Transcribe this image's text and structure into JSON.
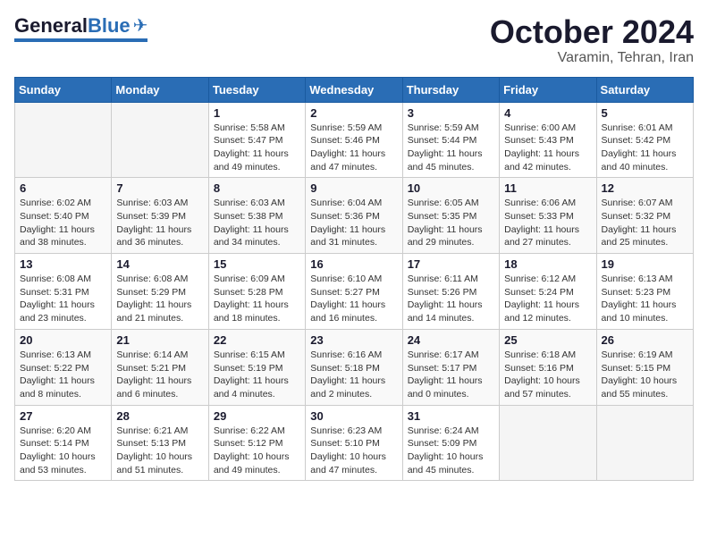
{
  "logo": {
    "general": "General",
    "blue": "Blue",
    "tagline": ""
  },
  "header": {
    "month_title": "October 2024",
    "subtitle": "Varamin, Tehran, Iran"
  },
  "days_of_week": [
    "Sunday",
    "Monday",
    "Tuesday",
    "Wednesday",
    "Thursday",
    "Friday",
    "Saturday"
  ],
  "weeks": [
    [
      {
        "day": "",
        "sunrise": "",
        "sunset": "",
        "daylight": ""
      },
      {
        "day": "",
        "sunrise": "",
        "sunset": "",
        "daylight": ""
      },
      {
        "day": "1",
        "sunrise": "Sunrise: 5:58 AM",
        "sunset": "Sunset: 5:47 PM",
        "daylight": "Daylight: 11 hours and 49 minutes."
      },
      {
        "day": "2",
        "sunrise": "Sunrise: 5:59 AM",
        "sunset": "Sunset: 5:46 PM",
        "daylight": "Daylight: 11 hours and 47 minutes."
      },
      {
        "day": "3",
        "sunrise": "Sunrise: 5:59 AM",
        "sunset": "Sunset: 5:44 PM",
        "daylight": "Daylight: 11 hours and 45 minutes."
      },
      {
        "day": "4",
        "sunrise": "Sunrise: 6:00 AM",
        "sunset": "Sunset: 5:43 PM",
        "daylight": "Daylight: 11 hours and 42 minutes."
      },
      {
        "day": "5",
        "sunrise": "Sunrise: 6:01 AM",
        "sunset": "Sunset: 5:42 PM",
        "daylight": "Daylight: 11 hours and 40 minutes."
      }
    ],
    [
      {
        "day": "6",
        "sunrise": "Sunrise: 6:02 AM",
        "sunset": "Sunset: 5:40 PM",
        "daylight": "Daylight: 11 hours and 38 minutes."
      },
      {
        "day": "7",
        "sunrise": "Sunrise: 6:03 AM",
        "sunset": "Sunset: 5:39 PM",
        "daylight": "Daylight: 11 hours and 36 minutes."
      },
      {
        "day": "8",
        "sunrise": "Sunrise: 6:03 AM",
        "sunset": "Sunset: 5:38 PM",
        "daylight": "Daylight: 11 hours and 34 minutes."
      },
      {
        "day": "9",
        "sunrise": "Sunrise: 6:04 AM",
        "sunset": "Sunset: 5:36 PM",
        "daylight": "Daylight: 11 hours and 31 minutes."
      },
      {
        "day": "10",
        "sunrise": "Sunrise: 6:05 AM",
        "sunset": "Sunset: 5:35 PM",
        "daylight": "Daylight: 11 hours and 29 minutes."
      },
      {
        "day": "11",
        "sunrise": "Sunrise: 6:06 AM",
        "sunset": "Sunset: 5:33 PM",
        "daylight": "Daylight: 11 hours and 27 minutes."
      },
      {
        "day": "12",
        "sunrise": "Sunrise: 6:07 AM",
        "sunset": "Sunset: 5:32 PM",
        "daylight": "Daylight: 11 hours and 25 minutes."
      }
    ],
    [
      {
        "day": "13",
        "sunrise": "Sunrise: 6:08 AM",
        "sunset": "Sunset: 5:31 PM",
        "daylight": "Daylight: 11 hours and 23 minutes."
      },
      {
        "day": "14",
        "sunrise": "Sunrise: 6:08 AM",
        "sunset": "Sunset: 5:29 PM",
        "daylight": "Daylight: 11 hours and 21 minutes."
      },
      {
        "day": "15",
        "sunrise": "Sunrise: 6:09 AM",
        "sunset": "Sunset: 5:28 PM",
        "daylight": "Daylight: 11 hours and 18 minutes."
      },
      {
        "day": "16",
        "sunrise": "Sunrise: 6:10 AM",
        "sunset": "Sunset: 5:27 PM",
        "daylight": "Daylight: 11 hours and 16 minutes."
      },
      {
        "day": "17",
        "sunrise": "Sunrise: 6:11 AM",
        "sunset": "Sunset: 5:26 PM",
        "daylight": "Daylight: 11 hours and 14 minutes."
      },
      {
        "day": "18",
        "sunrise": "Sunrise: 6:12 AM",
        "sunset": "Sunset: 5:24 PM",
        "daylight": "Daylight: 11 hours and 12 minutes."
      },
      {
        "day": "19",
        "sunrise": "Sunrise: 6:13 AM",
        "sunset": "Sunset: 5:23 PM",
        "daylight": "Daylight: 11 hours and 10 minutes."
      }
    ],
    [
      {
        "day": "20",
        "sunrise": "Sunrise: 6:13 AM",
        "sunset": "Sunset: 5:22 PM",
        "daylight": "Daylight: 11 hours and 8 minutes."
      },
      {
        "day": "21",
        "sunrise": "Sunrise: 6:14 AM",
        "sunset": "Sunset: 5:21 PM",
        "daylight": "Daylight: 11 hours and 6 minutes."
      },
      {
        "day": "22",
        "sunrise": "Sunrise: 6:15 AM",
        "sunset": "Sunset: 5:19 PM",
        "daylight": "Daylight: 11 hours and 4 minutes."
      },
      {
        "day": "23",
        "sunrise": "Sunrise: 6:16 AM",
        "sunset": "Sunset: 5:18 PM",
        "daylight": "Daylight: 11 hours and 2 minutes."
      },
      {
        "day": "24",
        "sunrise": "Sunrise: 6:17 AM",
        "sunset": "Sunset: 5:17 PM",
        "daylight": "Daylight: 11 hours and 0 minutes."
      },
      {
        "day": "25",
        "sunrise": "Sunrise: 6:18 AM",
        "sunset": "Sunset: 5:16 PM",
        "daylight": "Daylight: 10 hours and 57 minutes."
      },
      {
        "day": "26",
        "sunrise": "Sunrise: 6:19 AM",
        "sunset": "Sunset: 5:15 PM",
        "daylight": "Daylight: 10 hours and 55 minutes."
      }
    ],
    [
      {
        "day": "27",
        "sunrise": "Sunrise: 6:20 AM",
        "sunset": "Sunset: 5:14 PM",
        "daylight": "Daylight: 10 hours and 53 minutes."
      },
      {
        "day": "28",
        "sunrise": "Sunrise: 6:21 AM",
        "sunset": "Sunset: 5:13 PM",
        "daylight": "Daylight: 10 hours and 51 minutes."
      },
      {
        "day": "29",
        "sunrise": "Sunrise: 6:22 AM",
        "sunset": "Sunset: 5:12 PM",
        "daylight": "Daylight: 10 hours and 49 minutes."
      },
      {
        "day": "30",
        "sunrise": "Sunrise: 6:23 AM",
        "sunset": "Sunset: 5:10 PM",
        "daylight": "Daylight: 10 hours and 47 minutes."
      },
      {
        "day": "31",
        "sunrise": "Sunrise: 6:24 AM",
        "sunset": "Sunset: 5:09 PM",
        "daylight": "Daylight: 10 hours and 45 minutes."
      },
      {
        "day": "",
        "sunrise": "",
        "sunset": "",
        "daylight": ""
      },
      {
        "day": "",
        "sunrise": "",
        "sunset": "",
        "daylight": ""
      }
    ]
  ]
}
